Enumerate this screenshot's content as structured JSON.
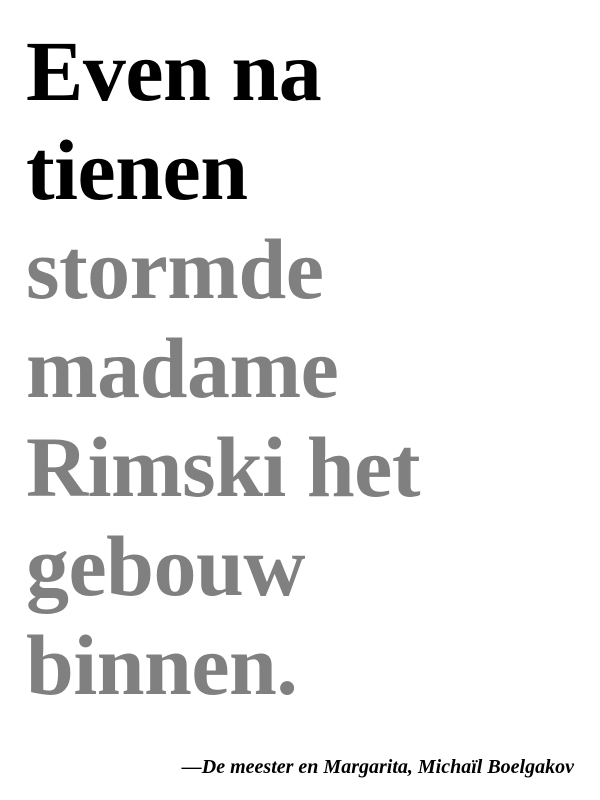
{
  "quote": {
    "lines": [
      {
        "text": "Even na",
        "emphasis": "strong"
      },
      {
        "text": "tienen",
        "emphasis": "strong"
      },
      {
        "text": "stormde",
        "emphasis": "faded"
      },
      {
        "text": "madame",
        "emphasis": "faded"
      },
      {
        "text": "Rimski het",
        "emphasis": "faded"
      },
      {
        "text": "gebouw",
        "emphasis": "faded"
      },
      {
        "text": "binnen.",
        "emphasis": "faded"
      }
    ]
  },
  "attribution": "—De meester en Margarita, Michaïl Boelgakov",
  "colors": {
    "strong": "#000000",
    "faded": "#808080",
    "background": "#ffffff"
  }
}
